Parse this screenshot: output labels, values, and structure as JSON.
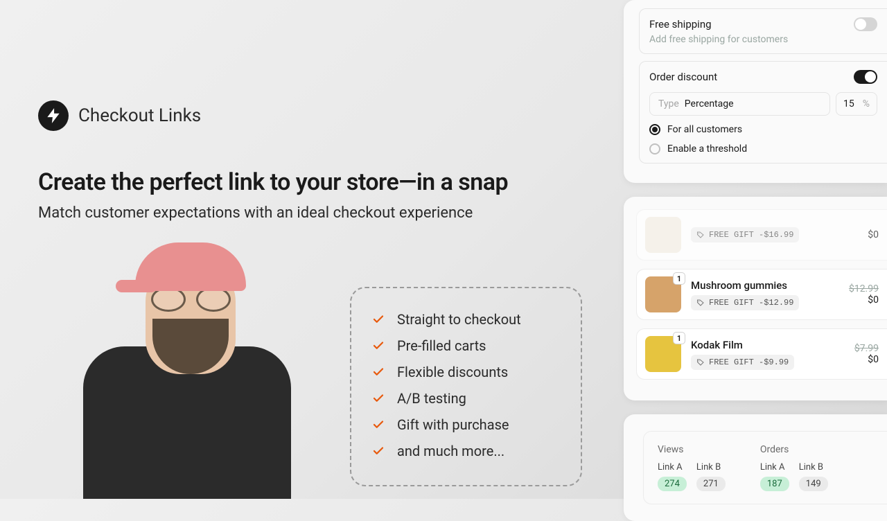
{
  "brand": {
    "name": "Checkout Links"
  },
  "hero": {
    "headline": "Create the perfect link to your store—in a snap",
    "subhead": "Match customer expectations with an ideal checkout experience"
  },
  "features": [
    "Straight to checkout",
    "Pre-filled carts",
    "Flexible discounts",
    "A/B testing",
    "Gift with purchase",
    "and much more..."
  ],
  "settings": {
    "free_shipping": {
      "label": "Free shipping",
      "sub": "Add free shipping for customers",
      "enabled": false
    },
    "order_discount": {
      "label": "Order discount",
      "enabled": true,
      "type_label": "Type",
      "type_value": "Percentage",
      "amount": "15",
      "unit": "%",
      "radios": {
        "all": "For all customers",
        "threshold": "Enable a threshold",
        "selected": "all"
      }
    }
  },
  "gift_items": [
    {
      "name": "",
      "qty": "",
      "badge_label": "FREE GIFT",
      "badge_amount": "-$16.99",
      "old_price": "",
      "new_price": "$0",
      "thumb_color": "#f4eee4",
      "faded": true
    },
    {
      "name": "Mushroom gummies",
      "qty": "1",
      "badge_label": "FREE GIFT",
      "badge_amount": "-$12.99",
      "old_price": "$12.99",
      "new_price": "$0",
      "thumb_color": "#d6a36a",
      "faded": false
    },
    {
      "name": "Kodak Film",
      "qty": "1",
      "badge_label": "FREE GIFT",
      "badge_amount": "-$9.99",
      "old_price": "$7.99",
      "new_price": "$0",
      "thumb_color": "#e6c43f",
      "faded": false
    }
  ],
  "stats": {
    "views": {
      "title": "Views",
      "a_label": "Link A",
      "a_value": "274",
      "a_win": true,
      "b_label": "Link B",
      "b_value": "271",
      "b_win": false
    },
    "orders": {
      "title": "Orders",
      "a_label": "Link A",
      "a_value": "187",
      "a_win": true,
      "b_label": "Link B",
      "b_value": "149",
      "b_win": false
    }
  }
}
